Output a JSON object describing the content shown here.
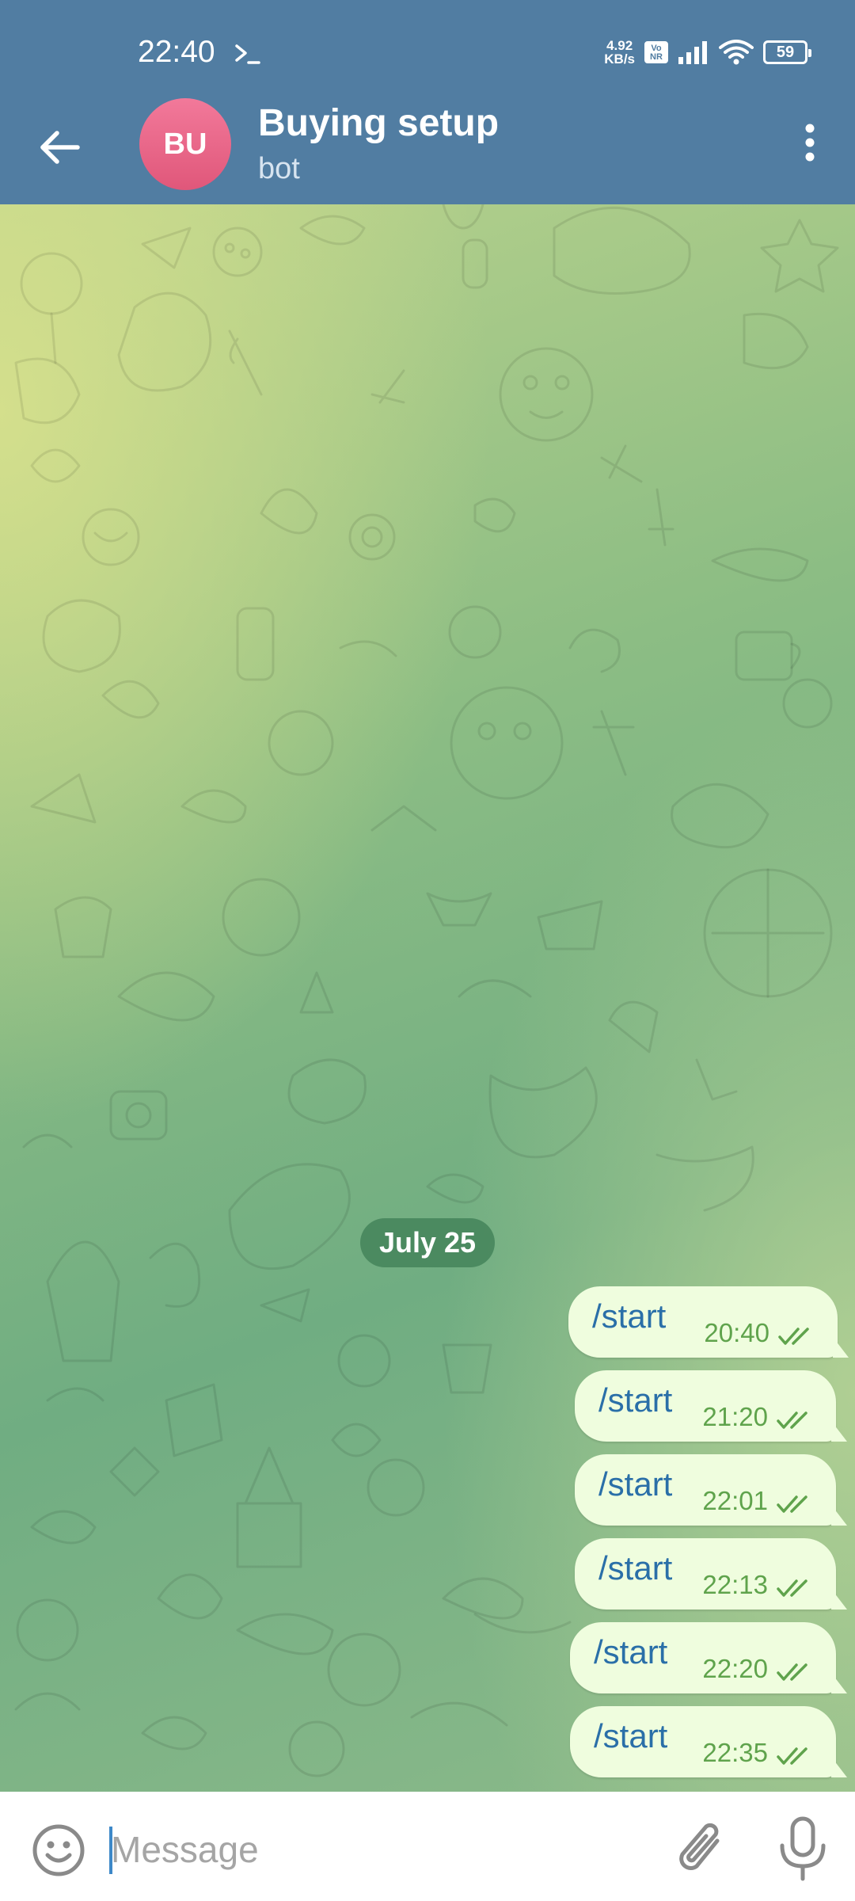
{
  "status_bar": {
    "time": "22:40",
    "network_speed_value": "4.92",
    "network_speed_unit": "KB/s",
    "volte_label": "Vo NR",
    "battery": "59",
    "icons": [
      "terminal-icon",
      "signal-icon",
      "wifi-icon",
      "battery-icon"
    ]
  },
  "header": {
    "avatar_initials": "BU",
    "title": "Buying setup",
    "subtitle": "bot",
    "avatar_color": "#e8668a",
    "bar_color": "#517da2"
  },
  "chat": {
    "date_label": "July 25",
    "messages": [
      {
        "text": "/start",
        "time": "20:40",
        "status": "read"
      },
      {
        "text": "/start",
        "time": "21:20",
        "status": "read"
      },
      {
        "text": "/start",
        "time": "22:01",
        "status": "read"
      },
      {
        "text": "/start",
        "time": "22:13",
        "status": "read"
      },
      {
        "text": "/start",
        "time": "22:20",
        "status": "read"
      },
      {
        "text": "/start",
        "time": "22:35",
        "status": "read"
      }
    ],
    "bubble_color": "#effdde",
    "check_color": "#5fa34c"
  },
  "input": {
    "placeholder": "Message",
    "icons": [
      "emoji-icon",
      "attach-icon",
      "mic-icon"
    ]
  }
}
